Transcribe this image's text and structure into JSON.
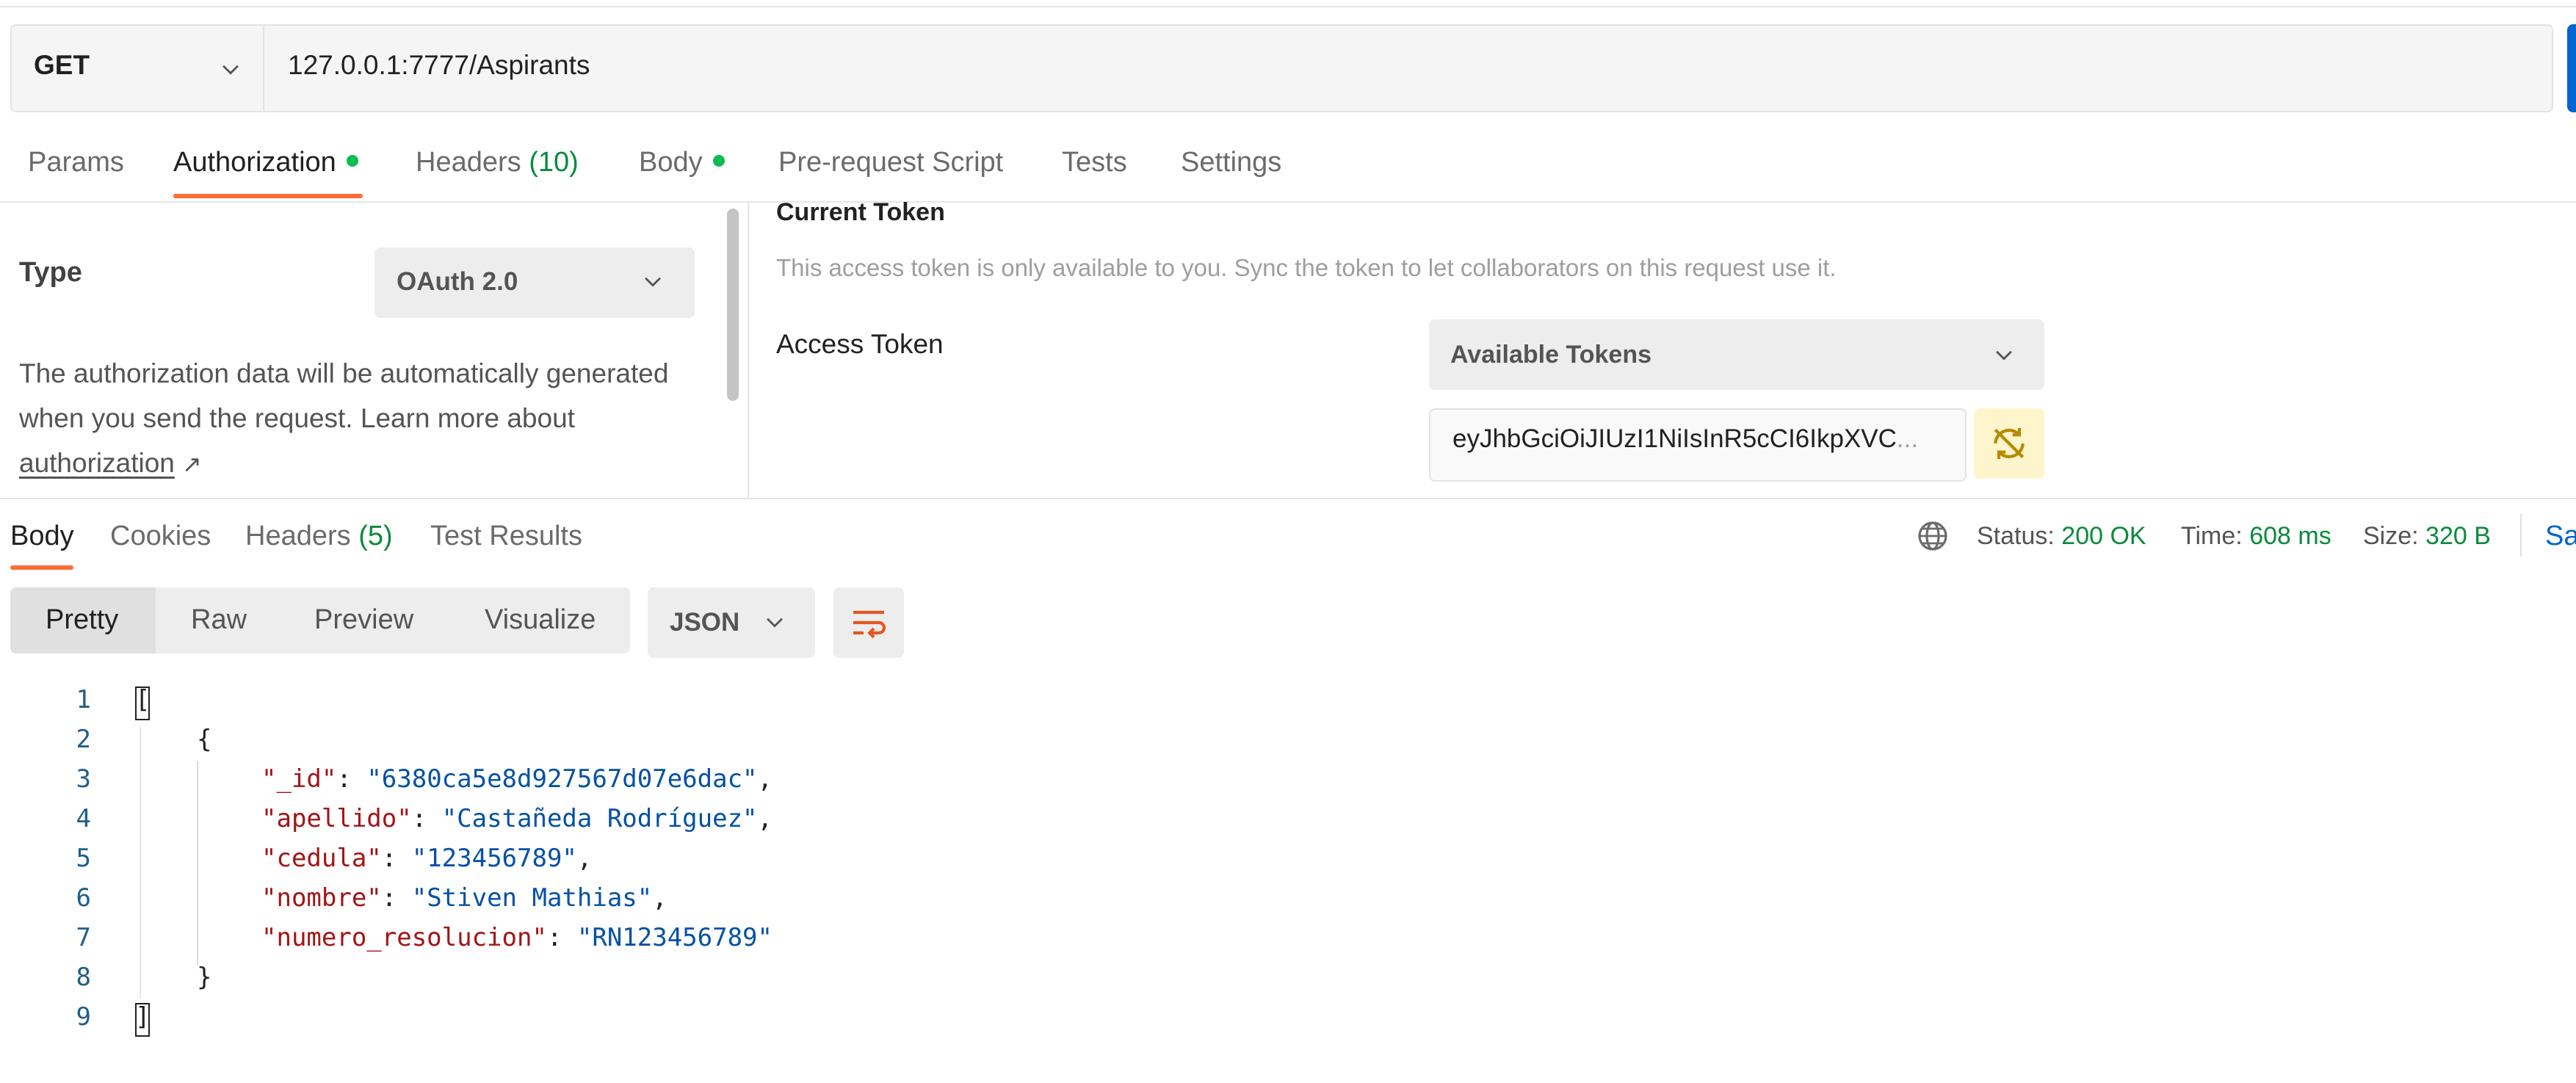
{
  "request": {
    "method": "GET",
    "url": "127.0.0.1:7777/Aspirants"
  },
  "request_tabs": {
    "params": "Params",
    "authorization": "Authorization",
    "headers": "Headers",
    "headers_count": "(10)",
    "body": "Body",
    "prerequest": "Pre-request Script",
    "tests": "Tests",
    "settings": "Settings"
  },
  "auth": {
    "type_label": "Type",
    "type_value": "OAuth 2.0",
    "desc_1": "The authorization data will be automatically generated when you send the request. Learn more about ",
    "desc_link": "authorization",
    "desc_arrow": "↗",
    "current_token_title": "Current Token",
    "token_help": "This access token is only available to you. Sync the token to let collaborators on this request use it.",
    "access_token_label": "Access Token",
    "available_tokens": "Available Tokens",
    "token_value": "eyJhbGciOiJIUzI1NiIsInR5cCI6IkpXVC",
    "token_ellipsis": "..."
  },
  "response_tabs": {
    "body": "Body",
    "cookies": "Cookies",
    "headers": "Headers",
    "headers_count": "(5)",
    "test_results": "Test Results"
  },
  "response_meta": {
    "status_label": "Status:",
    "status_value": "200 OK",
    "time_label": "Time:",
    "time_value": "608 ms",
    "size_label": "Size:",
    "size_value": "320 B",
    "save_partial": "Sa"
  },
  "view_modes": {
    "pretty": "Pretty",
    "raw": "Raw",
    "preview": "Preview",
    "visualize": "Visualize",
    "format": "JSON"
  },
  "code": {
    "line_numbers": [
      "1",
      "2",
      "3",
      "4",
      "5",
      "6",
      "7",
      "8",
      "9"
    ],
    "open_bracket": "[",
    "open_brace": "{",
    "close_brace": "}",
    "close_bracket": "]",
    "fields": [
      {
        "key": "\"_id\"",
        "value": "\"6380ca5e8d927567d07e6dac\""
      },
      {
        "key": "\"apellido\"",
        "value": "\"Castañeda Rodríguez\""
      },
      {
        "key": "\"cedula\"",
        "value": "\"123456789\""
      },
      {
        "key": "\"nombre\"",
        "value": "\"Stiven Mathias\""
      },
      {
        "key": "\"numero_resolucion\"",
        "value": "\"RN123456789\""
      }
    ]
  },
  "colors": {
    "accent": "#ff6c37",
    "status_green": "#0b8a3d",
    "dot_green": "#0cbb52",
    "json_key": "#a31515",
    "json_string": "#0451a5",
    "primary_blue": "#0265d2"
  },
  "icons": {
    "method_dropdown": "chevron-down-icon",
    "sync_token": "sync-off-icon",
    "network": "globe-icon",
    "wrap": "wrap-lines-icon"
  }
}
